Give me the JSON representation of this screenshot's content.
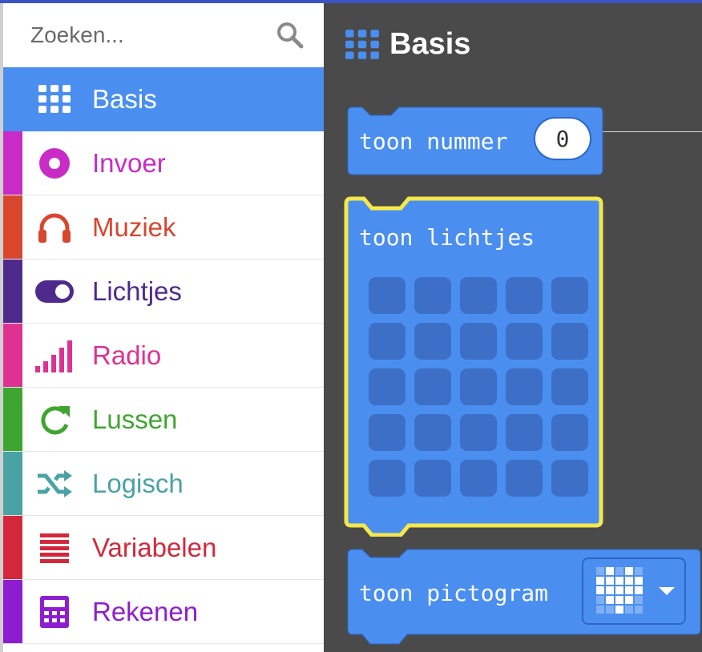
{
  "search": {
    "placeholder": "Zoeken..."
  },
  "categories": [
    {
      "label": "Basis",
      "color": "#4a8ef0",
      "icon": "grid-icon",
      "selected": true
    },
    {
      "label": "Invoer",
      "color": "#c92cc6",
      "icon": "circle-dot-icon"
    },
    {
      "label": "Muziek",
      "color": "#d8462e",
      "icon": "headphones-icon"
    },
    {
      "label": "Lichtjes",
      "color": "#4e2a8c",
      "icon": "toggle-icon"
    },
    {
      "label": "Radio",
      "color": "#dd3291",
      "icon": "signal-bars-icon"
    },
    {
      "label": "Lussen",
      "color": "#3fa531",
      "icon": "refresh-icon"
    },
    {
      "label": "Logisch",
      "color": "#4aa2a5",
      "icon": "shuffle-icon"
    },
    {
      "label": "Variabelen",
      "color": "#d3283c",
      "icon": "list-lines-icon"
    },
    {
      "label": "Rekenen",
      "color": "#8e1dd0",
      "icon": "calculator-icon"
    }
  ],
  "workspace": {
    "title": "Basis",
    "blocks": {
      "show_number": {
        "label": "toon nummer",
        "value": "0"
      },
      "show_leds": {
        "label": "toon lichtjes",
        "rows": 5,
        "cols": 5
      },
      "show_icon": {
        "label": "toon pictogram",
        "icon": "heart-icon"
      }
    }
  },
  "colors": {
    "block": "#4a8ef0",
    "block_dark": "#2f66c8",
    "highlight": "#f5e84a",
    "workspace_bg": "#4a4a4a"
  }
}
